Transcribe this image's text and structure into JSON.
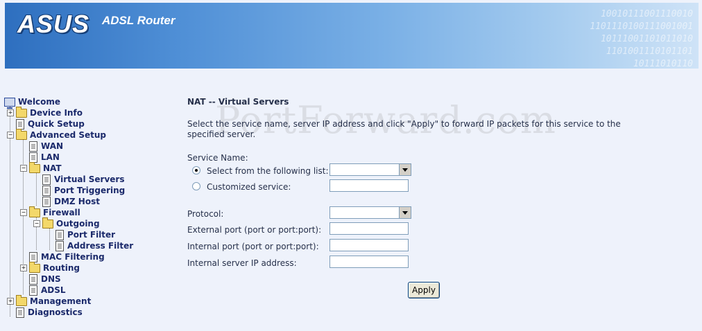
{
  "banner": {
    "logo": "ASUS",
    "product": "ADSL Router",
    "binary_lines": [
      "10010111001110010",
      "1101110100111001001",
      "10111001101011010",
      "1101001110101101",
      "10111010110"
    ]
  },
  "tree": {
    "welcome": "Welcome",
    "device_info": "Device Info",
    "quick_setup": "Quick Setup",
    "advanced_setup": "Advanced Setup",
    "wan": "WAN",
    "lan": "LAN",
    "nat": "NAT",
    "virtual_servers": "Virtual Servers",
    "port_triggering": "Port Triggering",
    "dmz_host": "DMZ Host",
    "firewall": "Firewall",
    "outgoing": "Outgoing",
    "port_filter": "Port Filter",
    "address_filter": "Address Filter",
    "mac_filtering": "MAC Filtering",
    "routing": "Routing",
    "dns": "DNS",
    "adsl": "ADSL",
    "management": "Management",
    "diagnostics": "Diagnostics"
  },
  "watermark": "PortForward.com",
  "form": {
    "title": "NAT -- Virtual Servers",
    "description": "Select the service name, server IP address and click \"Apply\" to forward IP packets for this service to the specified server.",
    "service_name_label": "Service Name:",
    "select_list_label": "Select from the following list:",
    "select_list_value": "",
    "customized_label": "Customized service:",
    "customized_value": "",
    "protocol_label": "Protocol:",
    "protocol_value": "",
    "external_port_label": "External port (port or port:port):",
    "external_port_value": "",
    "internal_port_label": "Internal port (port or port:port):",
    "internal_port_value": "",
    "server_ip_label": "Internal server IP address:",
    "server_ip_value": "",
    "apply_label": "Apply"
  }
}
